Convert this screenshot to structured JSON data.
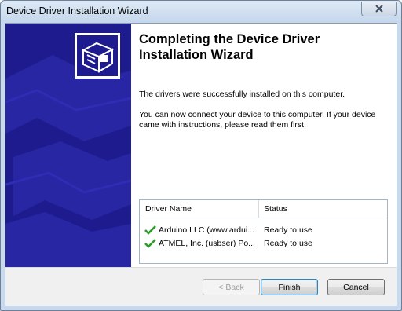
{
  "window": {
    "title": "Device Driver Installation Wizard"
  },
  "content": {
    "heading": "Completing the Device Driver Installation Wizard",
    "para1": "The drivers were successfully installed on this computer.",
    "para2": "You can now connect your device to this computer. If your device came with instructions, please read them first."
  },
  "table": {
    "headers": {
      "name": "Driver Name",
      "status": "Status"
    },
    "rows": [
      {
        "name": "Arduino LLC (www.ardui...",
        "status": "Ready to use"
      },
      {
        "name": "ATMEL, Inc. (usbser) Po...",
        "status": "Ready to use"
      }
    ]
  },
  "buttons": {
    "back": "< Back",
    "finish": "Finish",
    "cancel": "Cancel"
  },
  "colors": {
    "side_panel": "#1d1b8d",
    "check": "#2a9d2a"
  },
  "icons": {
    "close": "close-icon",
    "wizard": "hardware-device-icon",
    "check": "checkmark-icon"
  }
}
